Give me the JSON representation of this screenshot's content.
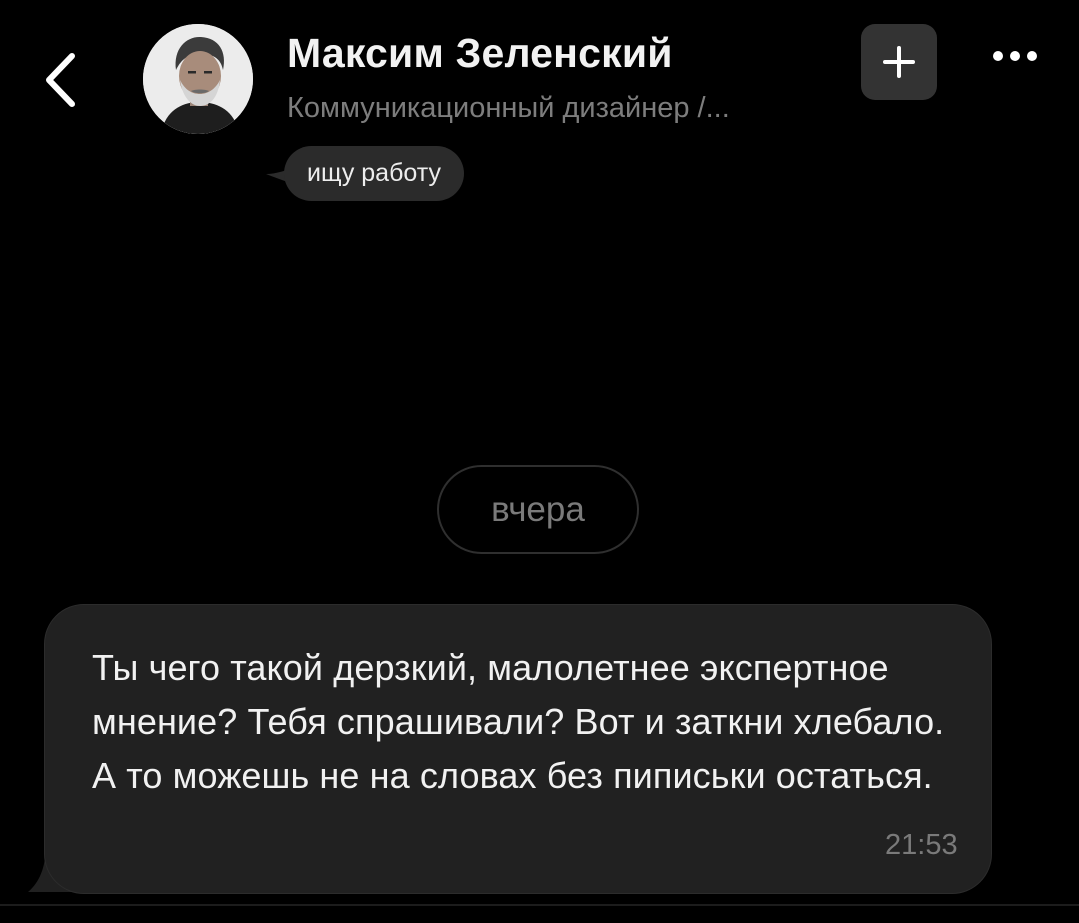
{
  "header": {
    "back_icon": "chevron-left-icon",
    "contact_name": "Максим Зеленский",
    "contact_subtitle": "Коммуникационный дизайнер /...",
    "status_text": "ищу работу",
    "add_icon": "plus-icon",
    "more_icon": "ellipsis-icon"
  },
  "chat": {
    "date_separator": "вчера",
    "messages": [
      {
        "text": "Ты чего такой дерзкий, малолетнее экспертное мнение? Тебя спрашивали? Вот и заткни хлебало. А то можешь не на словах без пиписьки остаться.",
        "time": "21:53"
      }
    ]
  },
  "colors": {
    "background": "#000000",
    "bubble": "#212121",
    "status_bubble": "#2b2b2b",
    "add_button": "#333333",
    "muted_text": "#7a7a7a"
  }
}
